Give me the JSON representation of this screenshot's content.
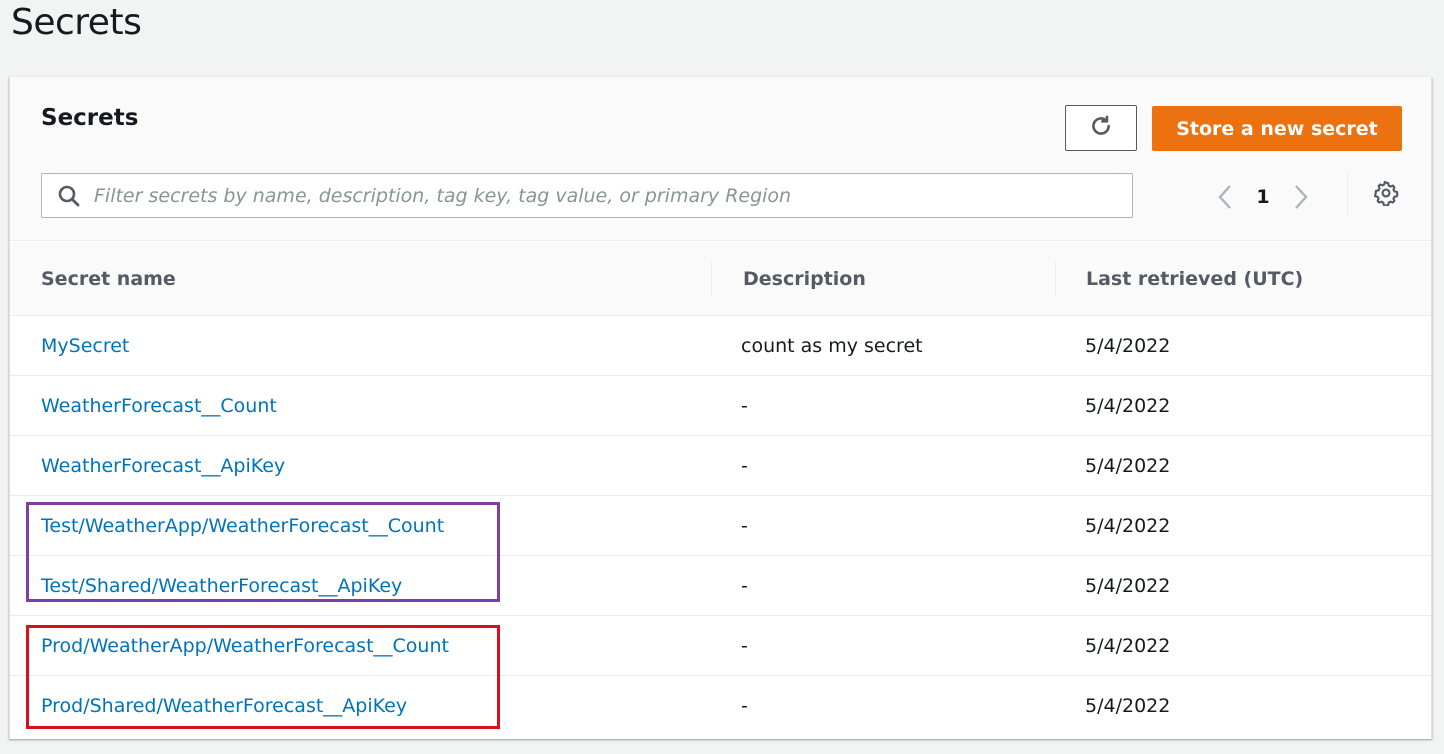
{
  "page": {
    "title": "Secrets"
  },
  "panel": {
    "title": "Secrets",
    "refresh_icon": "refresh-icon",
    "store_button_label": "Store a new secret",
    "search": {
      "placeholder": "Filter secrets by name, description, tag key, tag value, or primary Region",
      "value": "",
      "icon": "search-icon"
    },
    "pagination": {
      "current_page": "1",
      "prev_icon": "chevron-left-icon",
      "next_icon": "chevron-right-icon"
    },
    "settings_icon": "gear-icon"
  },
  "table": {
    "columns": [
      "Secret name",
      "Description",
      "Last retrieved (UTC)"
    ],
    "rows": [
      {
        "name": "MySecret",
        "description": "count as my secret",
        "last_retrieved": "5/4/2022"
      },
      {
        "name": "WeatherForecast__Count",
        "description": "-",
        "last_retrieved": "5/4/2022"
      },
      {
        "name": "WeatherForecast__ApiKey",
        "description": "-",
        "last_retrieved": "5/4/2022"
      },
      {
        "name": "Test/WeatherApp/WeatherForecast__Count",
        "description": "-",
        "last_retrieved": "5/4/2022"
      },
      {
        "name": "Test/Shared/WeatherForecast__ApiKey",
        "description": "-",
        "last_retrieved": "5/4/2022"
      },
      {
        "name": "Prod/WeatherApp/WeatherForecast__Count",
        "description": "-",
        "last_retrieved": "5/4/2022"
      },
      {
        "name": "Prod/Shared/WeatherForecast__ApiKey",
        "description": "-",
        "last_retrieved": "5/4/2022"
      }
    ]
  },
  "annotations": {
    "test_group_color": "#7d3fa7",
    "prod_group_color": "#d9101b"
  },
  "colors": {
    "primary_button": "#ec7211",
    "link": "#0073bb"
  }
}
